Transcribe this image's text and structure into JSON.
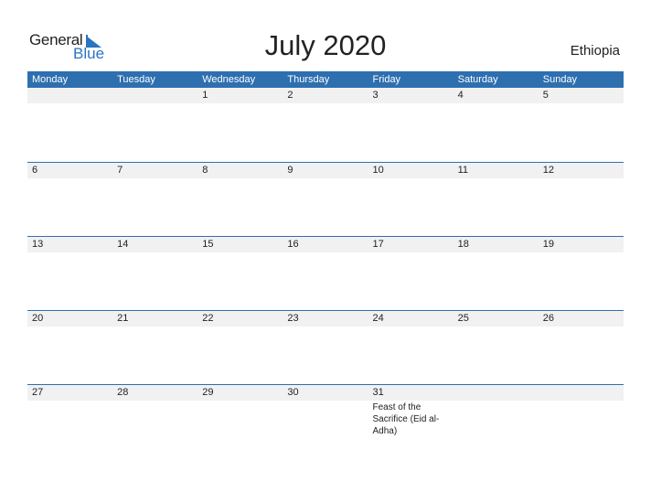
{
  "brand": {
    "word1": "General",
    "word2": "Blue",
    "color": "#2a74c0"
  },
  "title": "July 2020",
  "country": "Ethiopia",
  "header_color": "#2e6fb0",
  "weekdays": [
    "Monday",
    "Tuesday",
    "Wednesday",
    "Thursday",
    "Friday",
    "Saturday",
    "Sunday"
  ],
  "weeks": [
    {
      "days": [
        "",
        "",
        "1",
        "2",
        "3",
        "4",
        "5"
      ],
      "events": [
        "",
        "",
        "",
        "",
        "",
        "",
        ""
      ]
    },
    {
      "days": [
        "6",
        "7",
        "8",
        "9",
        "10",
        "11",
        "12"
      ],
      "events": [
        "",
        "",
        "",
        "",
        "",
        "",
        ""
      ]
    },
    {
      "days": [
        "13",
        "14",
        "15",
        "16",
        "17",
        "18",
        "19"
      ],
      "events": [
        "",
        "",
        "",
        "",
        "",
        "",
        ""
      ]
    },
    {
      "days": [
        "20",
        "21",
        "22",
        "23",
        "24",
        "25",
        "26"
      ],
      "events": [
        "",
        "",
        "",
        "",
        "",
        "",
        ""
      ]
    },
    {
      "days": [
        "27",
        "28",
        "29",
        "30",
        "31",
        "",
        ""
      ],
      "events": [
        "",
        "",
        "",
        "",
        "Feast of the Sacrifice (Eid al-Adha)",
        "",
        ""
      ]
    }
  ]
}
